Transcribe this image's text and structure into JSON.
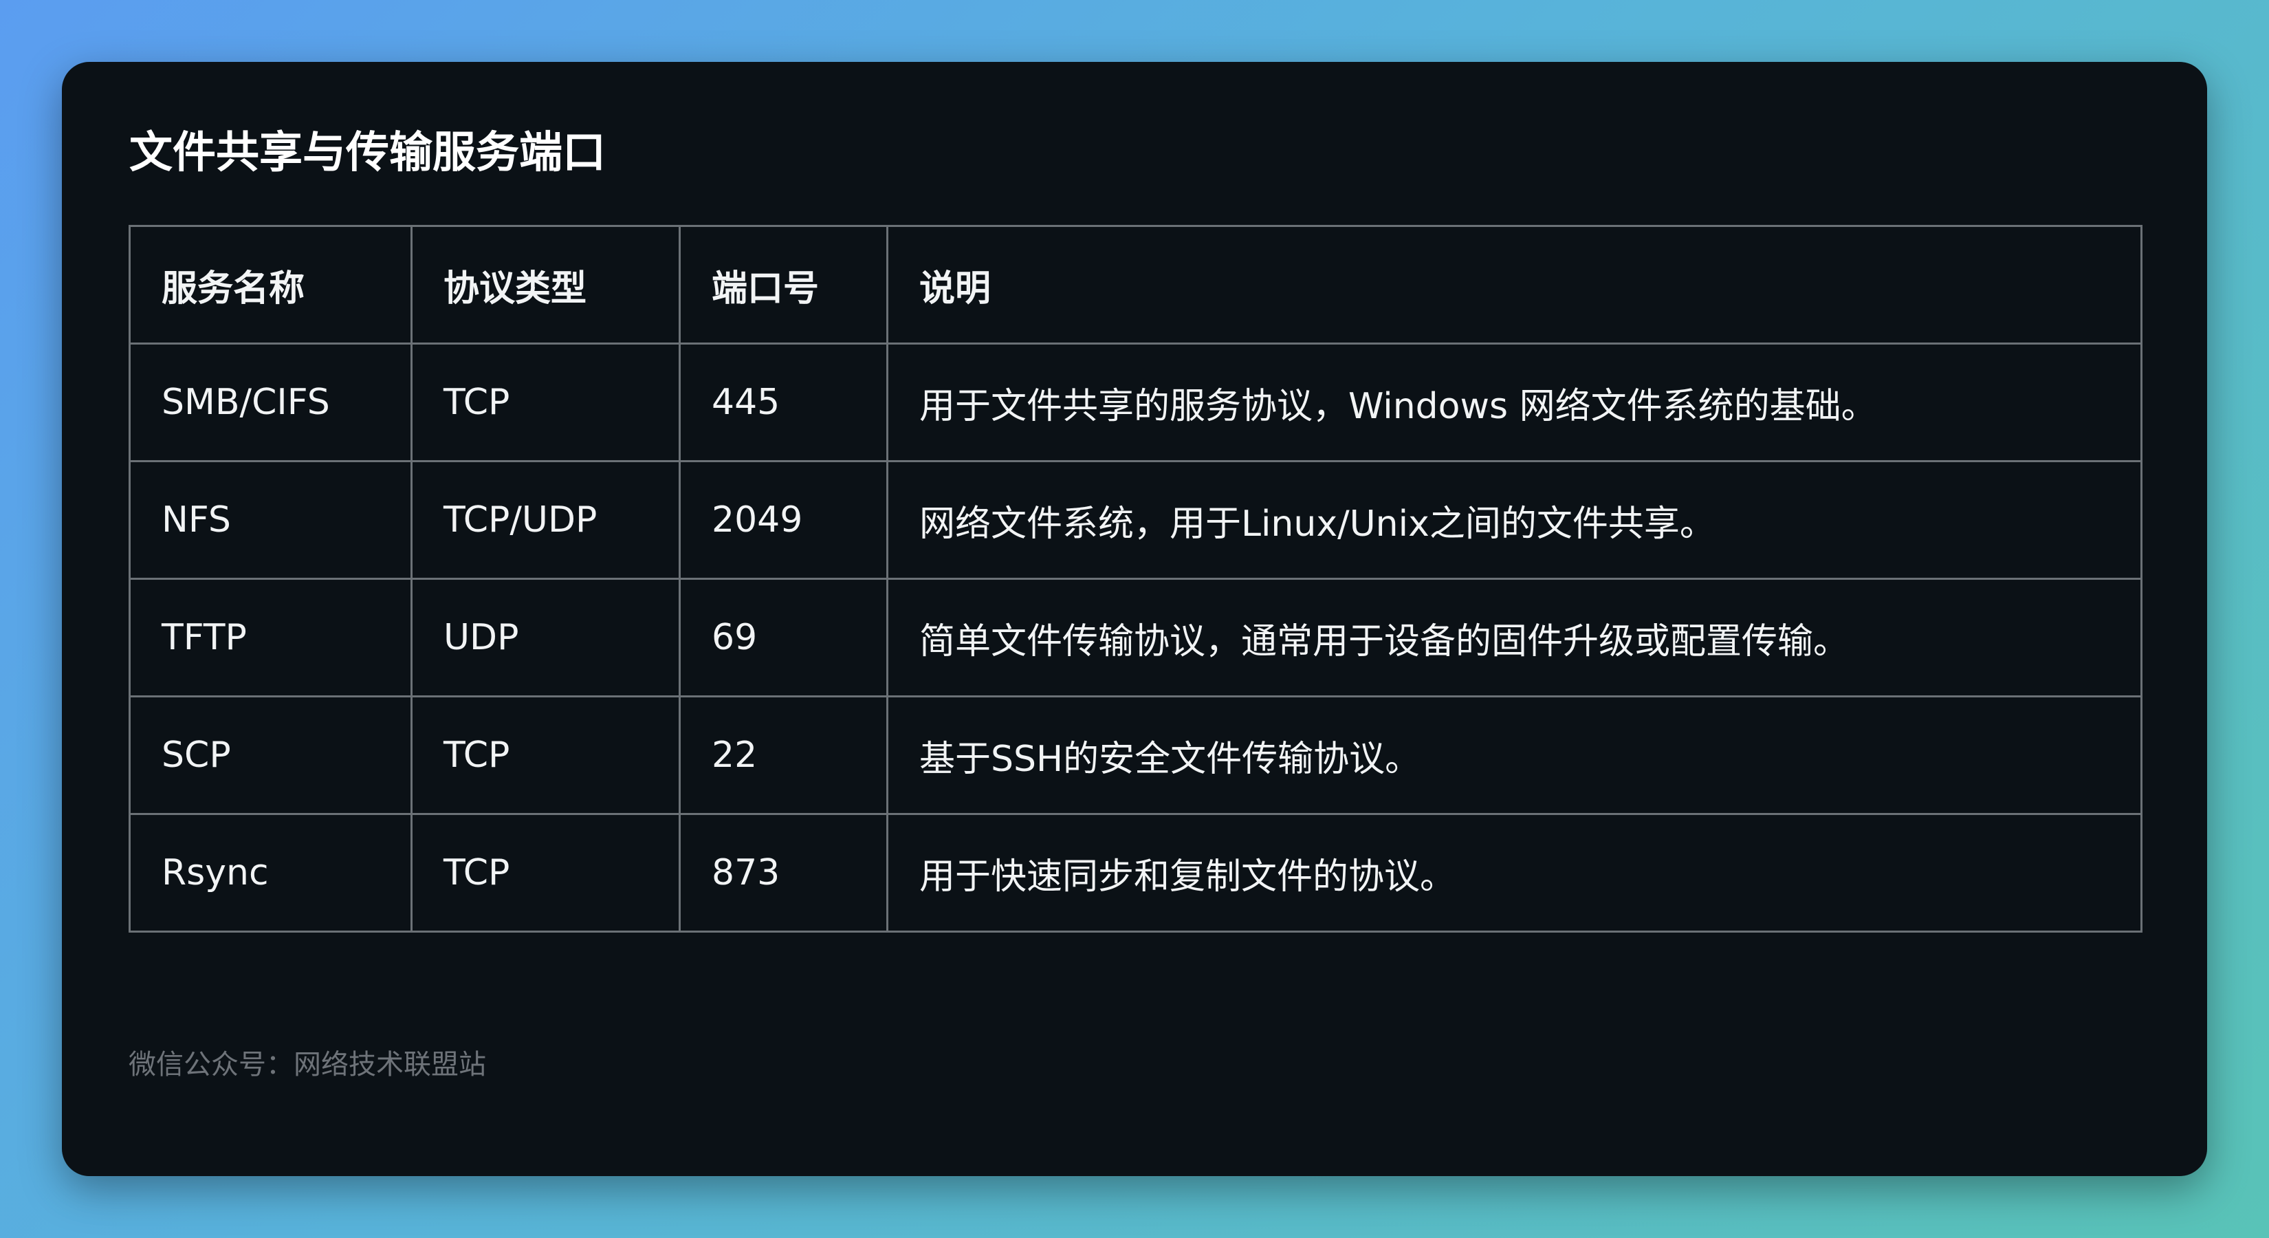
{
  "title": "文件共享与传输服务端口",
  "table": {
    "headers": [
      "服务名称",
      "协议类型",
      "端口号",
      "说明"
    ],
    "rows": [
      [
        "SMB/CIFS",
        "TCP",
        "445",
        "用于文件共享的服务协议，Windows 网络文件系统的基础。"
      ],
      [
        "NFS",
        "TCP/UDP",
        "2049",
        "网络文件系统，用于Linux/Unix之间的文件共享。"
      ],
      [
        "TFTP",
        "UDP",
        "69",
        "简单文件传输协议，通常用于设备的固件升级或配置传输。"
      ],
      [
        "SCP",
        "TCP",
        "22",
        "基于SSH的安全文件传输协议。"
      ],
      [
        "Rsync",
        "TCP",
        "873",
        "用于快速同步和复制文件的协议。"
      ]
    ]
  },
  "footer": "微信公众号：网络技术联盟站",
  "colors": {
    "card_background": "#0b1116",
    "border": "#6b7176",
    "text": "#f2f4f5",
    "footer_text": "#6e7379"
  }
}
